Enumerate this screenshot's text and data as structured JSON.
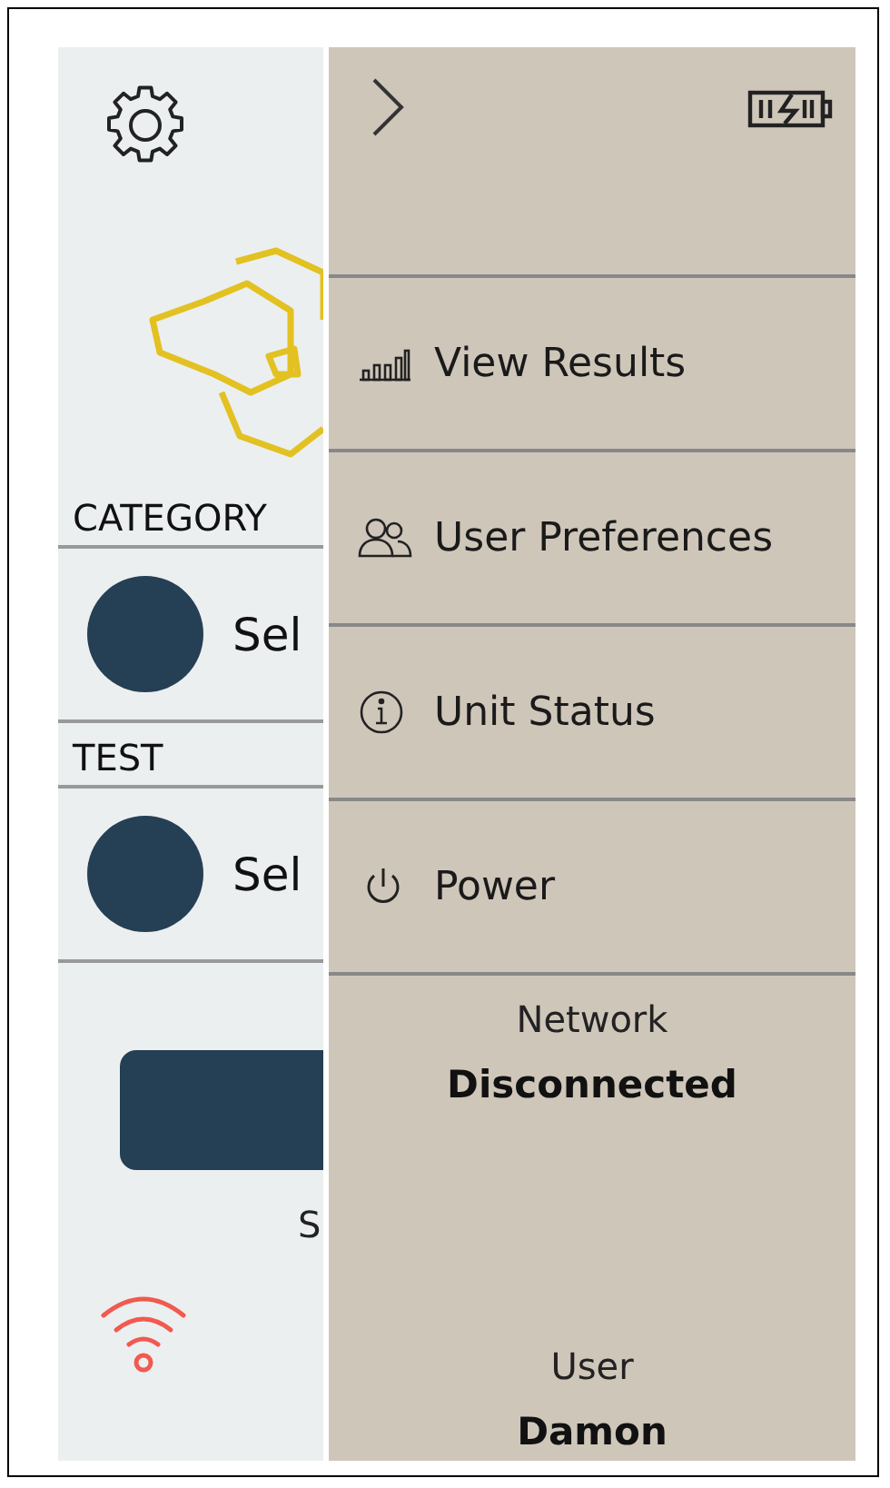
{
  "background": {
    "category_label": "CATEGORY",
    "category_select": "Sel",
    "test_label": "TEST",
    "test_select": "Sel",
    "mode_text": "S"
  },
  "drawer": {
    "menu": [
      {
        "kind": "results",
        "label": "View Results"
      },
      {
        "kind": "users",
        "label": "User Preferences"
      },
      {
        "kind": "info",
        "label": "Unit Status"
      },
      {
        "kind": "power",
        "label": "Power"
      }
    ],
    "network": {
      "label": "Network",
      "value": "Disconnected"
    },
    "user": {
      "label": "User",
      "value": "Damon"
    }
  }
}
